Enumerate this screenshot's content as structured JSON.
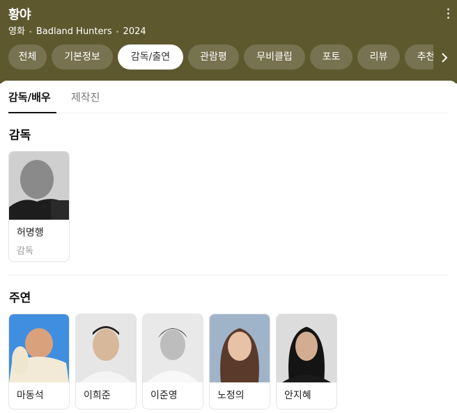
{
  "header": {
    "title": "황야",
    "meta": [
      "영화",
      "Badland Hunters",
      "2024"
    ]
  },
  "tabs": [
    {
      "label": "전체",
      "active": false
    },
    {
      "label": "기본정보",
      "active": false
    },
    {
      "label": "감독/출연",
      "active": true
    },
    {
      "label": "관람평",
      "active": false
    },
    {
      "label": "무비클립",
      "active": false
    },
    {
      "label": "포토",
      "active": false
    },
    {
      "label": "리뷰",
      "active": false
    },
    {
      "label": "추천",
      "active": false
    }
  ],
  "subtabs": [
    {
      "label": "감독/배우",
      "active": true
    },
    {
      "label": "제작진",
      "active": false
    }
  ],
  "directors": {
    "title": "감독",
    "people": [
      {
        "name": "허명행",
        "role": "감독"
      }
    ]
  },
  "cast": {
    "title": "주연",
    "people": [
      {
        "name": "마동석"
      },
      {
        "name": "이희준"
      },
      {
        "name": "이준영"
      },
      {
        "name": "노정의"
      },
      {
        "name": "안지혜"
      }
    ]
  },
  "colors": {
    "header_bg": "#5e582e",
    "tab_active_bg": "#ffffff"
  },
  "icons": {
    "more": "more-vertical-icon",
    "next": "chevron-right-icon"
  }
}
